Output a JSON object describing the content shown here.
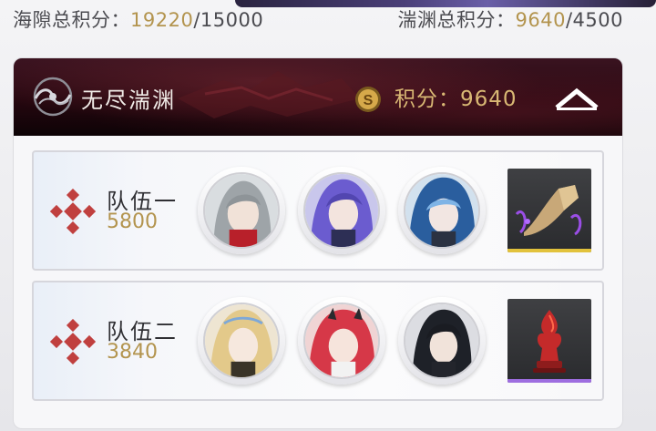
{
  "summary": {
    "sea_label": "海隙总积分：",
    "sea_current": "19220",
    "sea_target": "/15000",
    "abyss_label": "湍渊总积分：",
    "abyss_current": "9640",
    "abyss_target": "/4500"
  },
  "panel": {
    "title": "无尽湍渊",
    "points_text": "积分：9640",
    "icon": "abyss-swirl-icon",
    "coin_icon": "s-coin-icon",
    "collapse_icon": "chevron-up-icon"
  },
  "teams": [
    {
      "name": "队伍一",
      "score": "5800",
      "members": [
        "grey-haired-character-avatar",
        "purple-haired-character-avatar",
        "blue-hooded-character-avatar"
      ],
      "item": "golden-horn-relic",
      "rarity_color": "#e2c23c"
    },
    {
      "name": "队伍二",
      "score": "3840",
      "members": [
        "blonde-character-avatar",
        "red-haired-character-avatar",
        "black-haired-character-avatar"
      ],
      "item": "red-flame-chess-piece",
      "rarity_color": "#9e6ee0"
    }
  ],
  "colors": {
    "accent_gold": "#b3944e",
    "header_dark": "#25070f",
    "points_gold": "#d9b874"
  }
}
